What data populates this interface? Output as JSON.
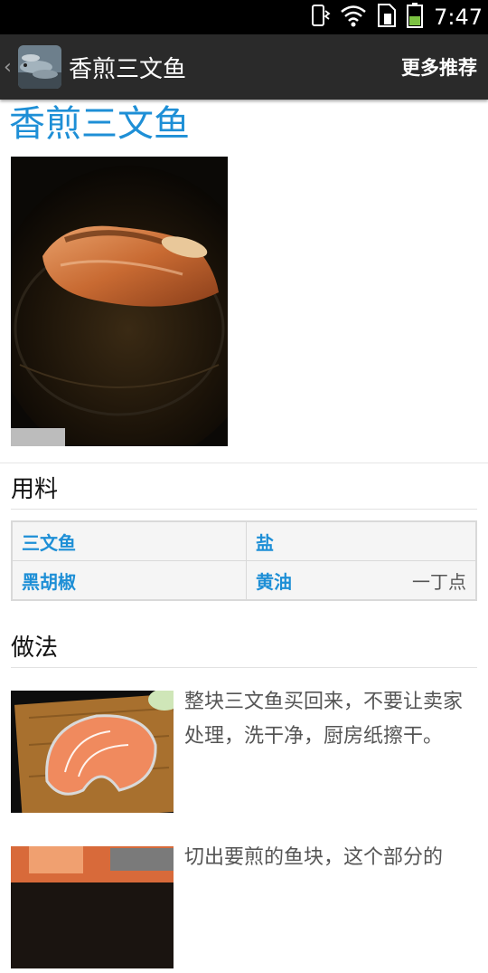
{
  "status_bar": {
    "time": "7:47",
    "icons": [
      "vibrate-icon",
      "wifi-icon",
      "sim-icon",
      "battery-icon"
    ]
  },
  "action_bar": {
    "title": "香煎三文鱼",
    "more_label": "更多推荐"
  },
  "recipe": {
    "title": "香煎三文鱼",
    "ingredients_heading": "用料",
    "ingredients": [
      {
        "name": "三文鱼",
        "qty": ""
      },
      {
        "name": "盐",
        "qty": ""
      },
      {
        "name": "黑胡椒",
        "qty": ""
      },
      {
        "name": "黄油",
        "qty": "一丁点"
      }
    ],
    "method_heading": "做法",
    "steps": [
      {
        "text": "整块三文鱼买回来，不要让卖家处理，洗干净，厨房纸擦干。"
      },
      {
        "text": "切出要煎的鱼块，这个部分的"
      }
    ]
  },
  "colors": {
    "accent": "#1e8fd6",
    "action_bar": "#2a2a2a",
    "status_bar": "#000000"
  }
}
